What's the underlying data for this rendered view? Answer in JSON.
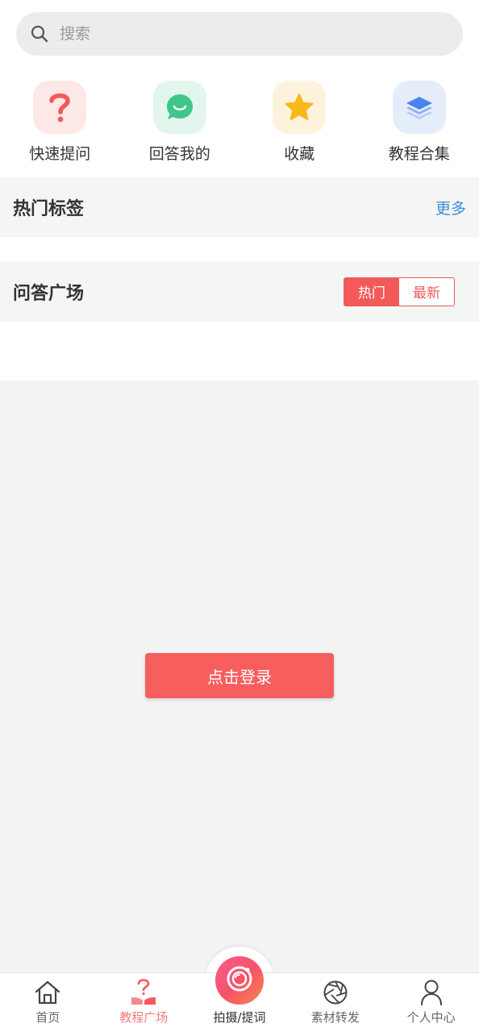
{
  "search": {
    "placeholder": "搜索",
    "icon": "search-icon"
  },
  "quick_actions": [
    {
      "label": "快速提问",
      "icon": "question-icon",
      "bg": "#fde8e8",
      "color": "#f25a5a"
    },
    {
      "label": "回答我的",
      "icon": "chat-bubble-icon",
      "bg": "#e3f6ee",
      "color": "#3fc68a"
    },
    {
      "label": "收藏",
      "icon": "star-icon",
      "bg": "#fdf3dc",
      "color": "#f7b818"
    },
    {
      "label": "教程合集",
      "icon": "layers-icon",
      "bg": "#e5edfb",
      "color": "#4b82ee"
    }
  ],
  "hot_tags": {
    "title": "热门标签",
    "more": "更多"
  },
  "qa_plaza": {
    "title": "问答广场",
    "toggle": {
      "hot": "热门",
      "newest": "最新"
    }
  },
  "login_button": "点击登录",
  "tabbar": [
    {
      "label": "首页",
      "icon": "home-icon"
    },
    {
      "label": "教程广场",
      "icon": "tutorial-book-icon",
      "active": true
    },
    {
      "label": "拍摄/提词",
      "icon": "camera-icon"
    },
    {
      "label": "素材转发",
      "icon": "aperture-icon"
    },
    {
      "label": "个人中心",
      "icon": "user-icon"
    }
  ],
  "colors": {
    "accent": "#f25a5a",
    "link": "#3d8fd6"
  }
}
